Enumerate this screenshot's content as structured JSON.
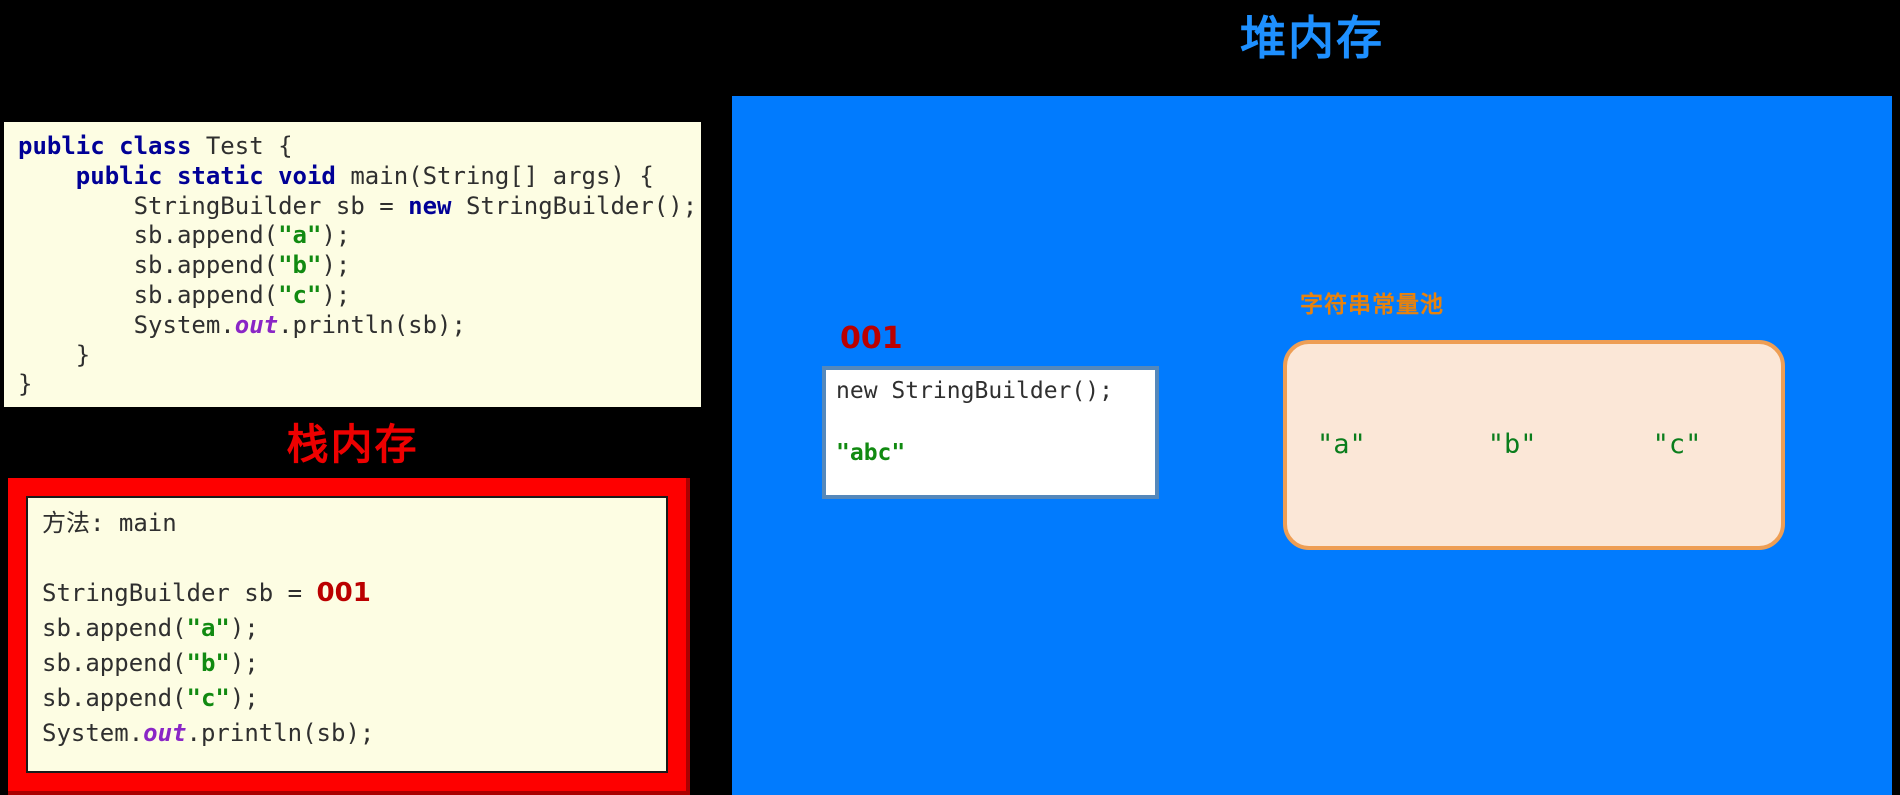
{
  "heap": {
    "title": "堆内存",
    "color": "#017BFE",
    "title_color": "#1E90FF",
    "object": {
      "id_label": "001",
      "id_color": "#BB0000",
      "lines": [
        {
          "text": "new StringBuilder();",
          "color": "#2F2F2F"
        },
        {
          "text": "",
          "color": "#2F2F2F"
        },
        {
          "text": "\"abc\"",
          "color": "#118A11"
        }
      ]
    },
    "string_pool": {
      "title": "字符串常量池",
      "title_color": "#E8820C",
      "border_color": "#EE9E54",
      "fill_color": "#FBE7D7",
      "items": [
        "\"a\"",
        "\"b\"",
        "\"c\""
      ],
      "item_color": "#0A7D1C"
    }
  },
  "stack": {
    "title": "栈内存",
    "title_color": "#EE0000",
    "border_color": "#FE0000",
    "frame": {
      "method_label": "方法: main",
      "variable_decl": "StringBuilder sb = ",
      "variable_value": "001",
      "statements": [
        "sb.append(\"a\");",
        "sb.append(\"b\");",
        "sb.append(\"c\");",
        "System.out.println(sb);"
      ]
    }
  },
  "code": {
    "background": "#FDFDE3",
    "lines": [
      "public class Test {",
      "    public static void main(String[] args) {",
      "        StringBuilder sb = new StringBuilder();",
      "        sb.append(\"a\");",
      "        sb.append(\"b\");",
      "        sb.append(\"c\");",
      "        System.out.println(sb);",
      "    }",
      "}"
    ]
  }
}
